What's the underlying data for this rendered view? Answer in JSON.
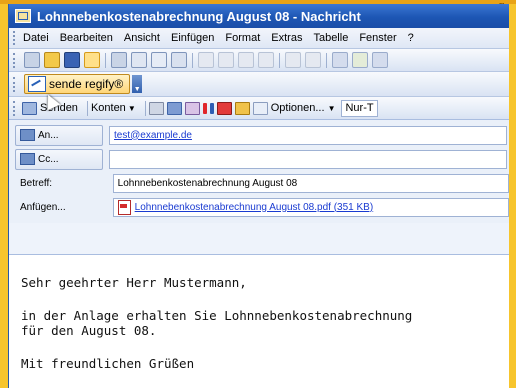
{
  "window": {
    "title": "Lohnnebenkostenabrechnung August 08 - Nachricht"
  },
  "menu": [
    "Datei",
    "Bearbeiten",
    "Ansicht",
    "Einfügen",
    "Format",
    "Extras",
    "Tabelle",
    "Fenster",
    "?"
  ],
  "regify": {
    "label": "sende regify®"
  },
  "msgbar": {
    "send_label": "Senden",
    "accounts_label": "Konten",
    "options_label": "Optionen...",
    "format_label": "Nur-T"
  },
  "headers": {
    "to_label": "An...",
    "to_value": "test@example.de",
    "cc_label": "Cc...",
    "cc_value": "",
    "subject_label": "Betreff:",
    "subject_value": "Lohnnebenkostenabrechnung August 08",
    "attach_label": "Anfügen...",
    "attach_value": "Lohnnebenkostenabrechnung August 08.pdf (351 KB)"
  },
  "body": {
    "greeting": "Sehr geehrter Herr Mustermann,",
    "line1": "in der Anlage erhalten Sie Lohnnebenkostenabrechnung",
    "line2": "für den August 08.",
    "closing": "Mit freundlichen Grüßen"
  },
  "colors": {
    "titlebar": "#1d56b4",
    "background": "#f7c52d",
    "link": "#1a3bd1"
  }
}
